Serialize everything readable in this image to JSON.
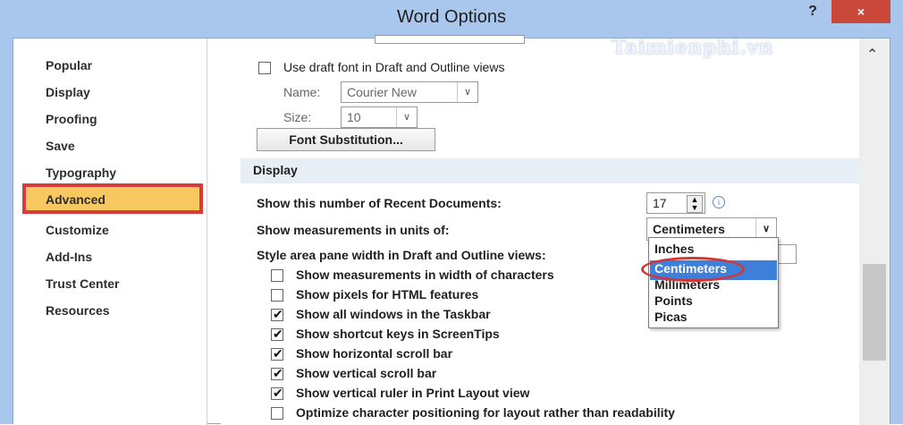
{
  "window": {
    "title": "Word Options",
    "help_label": "?",
    "close_label": "×",
    "watermark": "Taimienphi.vn"
  },
  "sidebar": {
    "items": [
      {
        "label": "Popular"
      },
      {
        "label": "Display"
      },
      {
        "label": "Proofing"
      },
      {
        "label": "Save"
      },
      {
        "label": "Typography"
      },
      {
        "label": "Advanced",
        "selected": true
      },
      {
        "label": "Customize"
      },
      {
        "label": "Add-Ins"
      },
      {
        "label": "Trust Center"
      },
      {
        "label": "Resources"
      }
    ]
  },
  "draft_font": {
    "checkbox_label": "Use draft font in Draft and Outline views",
    "checked": false,
    "name_label": "Name:",
    "name_value": "Courier New",
    "size_label": "Size:",
    "size_value": "10",
    "font_sub_button": "Font Substitution..."
  },
  "display": {
    "header": "Display",
    "recent_docs_label": "Show this number of Recent Documents:",
    "recent_docs_value": "17",
    "measure_label": "Show measurements in units of:",
    "measure_value": "Centimeters",
    "style_area_label": "Style area pane width in Draft and Outline views:",
    "unit_options": [
      "Inches",
      "Centimeters",
      "Millimeters",
      "Points",
      "Picas"
    ],
    "options": [
      {
        "label": "Show measurements in width of characters",
        "checked": false
      },
      {
        "label": "Show pixels for HTML features",
        "checked": false
      },
      {
        "label": "Show all windows in the Taskbar",
        "checked": true
      },
      {
        "label": "Show shortcut keys in ScreenTips",
        "checked": true
      },
      {
        "label": "Show horizontal scroll bar",
        "checked": true
      },
      {
        "label": "Show vertical scroll bar",
        "checked": true
      },
      {
        "label": "Show vertical ruler in Print Layout view",
        "checked": true
      },
      {
        "label": "Optimize character positioning for layout rather than readability",
        "checked": false
      }
    ]
  },
  "colors": {
    "titlebar": "#a9c7ec",
    "close_button": "#c9483a",
    "selected_item": "#f6c85f",
    "highlight_box": "#d93a3a",
    "dropdown_highlight": "#3d7fd9"
  }
}
